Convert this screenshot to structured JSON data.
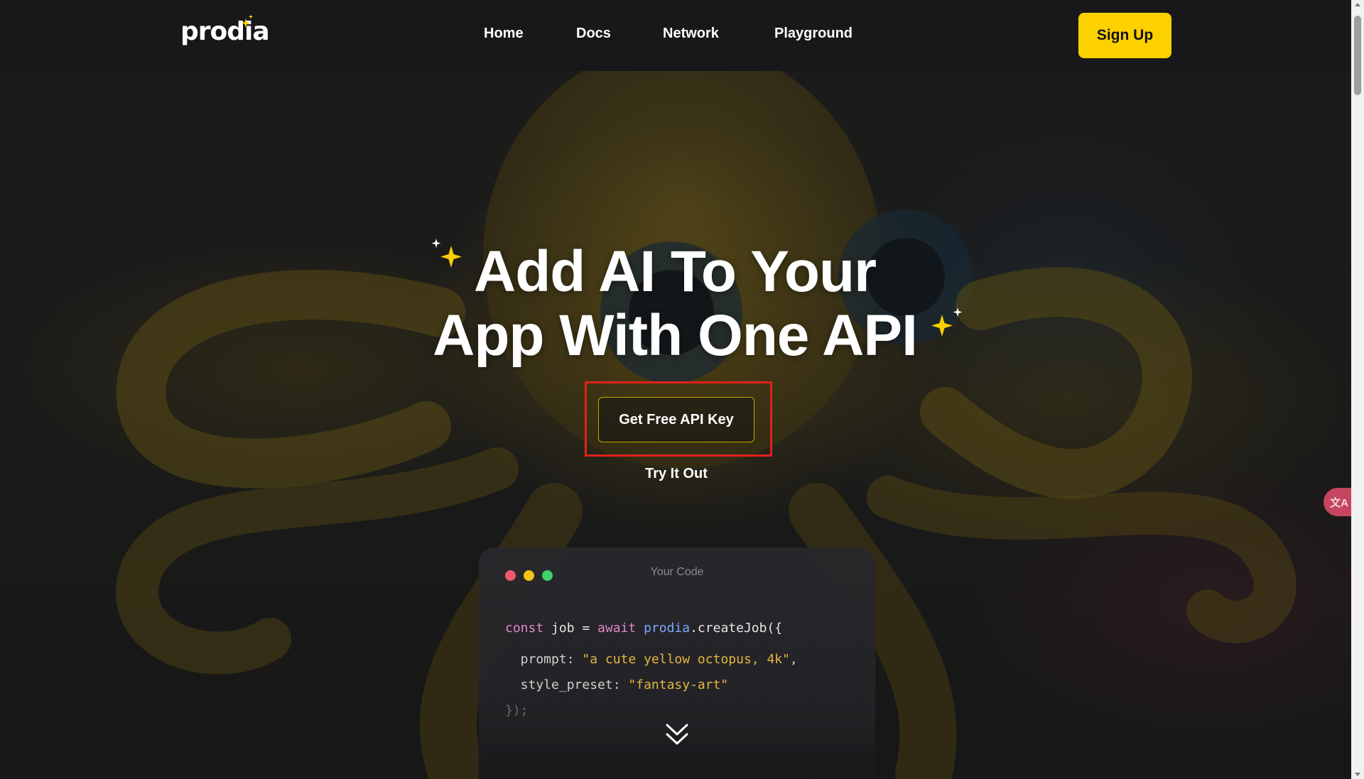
{
  "nav": {
    "logo_text": "prodia",
    "links": [
      "Home",
      "Docs",
      "Network",
      "Playground"
    ],
    "signup_label": "Sign Up"
  },
  "hero": {
    "headline_line1": "Add AI To Your",
    "headline_line2": "App With One API",
    "cta_label": "Get Free API Key",
    "secondary_label": "Try It Out"
  },
  "code_card": {
    "title": "Your Code",
    "line1": {
      "kw1": "const",
      "var": " job = ",
      "kw2": "await",
      "obj": " prodia",
      "rest": ".createJob({"
    },
    "line2": {
      "key": "  prompt: ",
      "value": "\"a cute yellow octopus, 4k\"",
      "tail": ","
    },
    "line3": {
      "key": "  style_preset: ",
      "value": "\"fantasy-art\""
    },
    "line4": "});"
  },
  "icons": {
    "sparkle": "sparkle-icon",
    "chevron": "double-chevron-down-icon",
    "translate": "translate-icon"
  },
  "translate_label": "文A",
  "colors": {
    "accent_yellow": "#fdd100",
    "nav_bg": "#18181a",
    "highlight_red": "#e2221a",
    "dot_red": "#f05a6c",
    "dot_yellow": "#f5c418",
    "dot_green": "#3fd16a"
  }
}
